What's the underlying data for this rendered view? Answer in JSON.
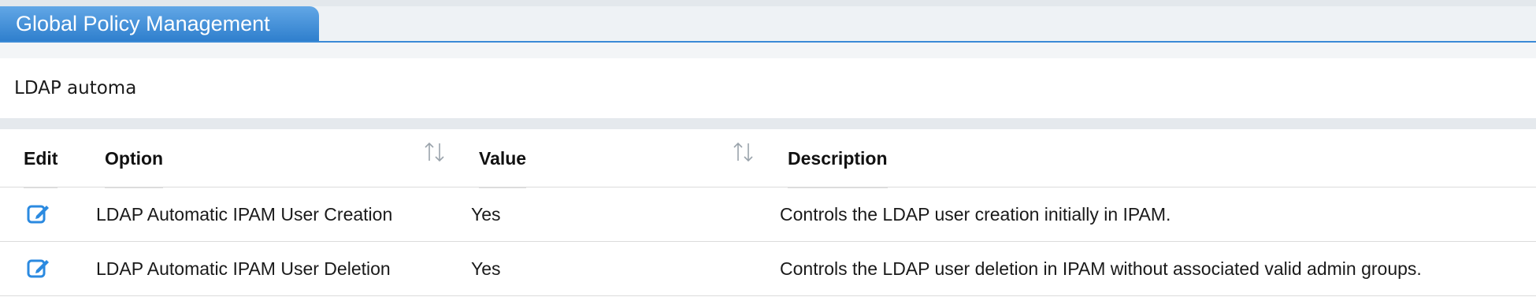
{
  "tab": {
    "title": "Global Policy Management"
  },
  "search": {
    "value": "LDAP automa"
  },
  "table": {
    "columns": [
      "Edit",
      "Option",
      "Value",
      "Description"
    ],
    "rows": [
      {
        "option": "LDAP Automatic IPAM User Creation",
        "value": "Yes",
        "description": "Controls the LDAP user creation initially in IPAM."
      },
      {
        "option": "LDAP Automatic IPAM User Deletion",
        "value": "Yes",
        "description": "Controls the LDAP user deletion in IPAM without associated valid admin groups."
      }
    ]
  },
  "icons": {
    "edit": "edit-icon",
    "sort": "sort-icon"
  },
  "colors": {
    "accent": "#2f7fcd",
    "icon": "#2b8ae0"
  }
}
